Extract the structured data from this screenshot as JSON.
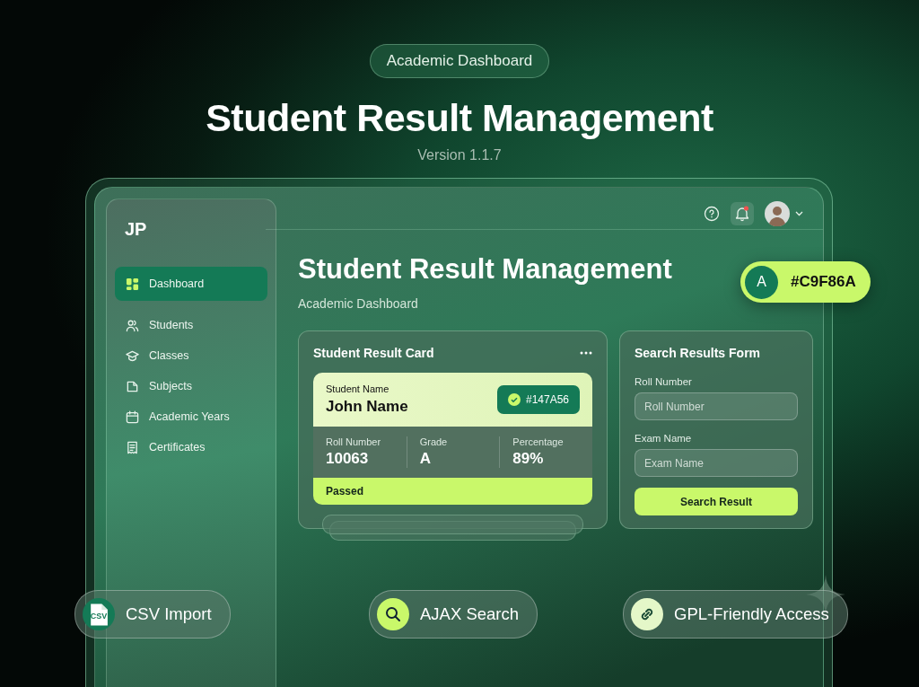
{
  "hero": {
    "badge": "Academic Dashboard",
    "title": "Student Result Management",
    "version": "Version 1.1.7"
  },
  "sidebar": {
    "logo": "JP",
    "items": [
      {
        "label": "Dashboard",
        "selected": true
      },
      {
        "label": "Students",
        "selected": false
      },
      {
        "label": "Classes",
        "selected": false
      },
      {
        "label": "Subjects",
        "selected": false
      },
      {
        "label": "Academic Years",
        "selected": false
      },
      {
        "label": "Certificates",
        "selected": false
      }
    ]
  },
  "page": {
    "title": "Student Result Management",
    "subtitle": "Academic Dashboard"
  },
  "color_chip": {
    "letter": "A",
    "label": "#C9F86A"
  },
  "result_card": {
    "title": "Student Result Card",
    "student_label": "Student Name",
    "student_name": "John Name",
    "badge": "#147A56",
    "stats": [
      {
        "label": "Roll Number",
        "value": "10063"
      },
      {
        "label": "Grade",
        "value": "A"
      },
      {
        "label": "Percentage",
        "value": "89%"
      }
    ],
    "status": "Passed"
  },
  "search_form": {
    "title": "Search Results Form",
    "fields": [
      {
        "label": "Roll Number",
        "placeholder": "Roll Number"
      },
      {
        "label": "Exam Name",
        "placeholder": "Exam Name"
      }
    ],
    "button": "Search Result"
  },
  "features": [
    {
      "kind": "csv",
      "label": "CSV Import",
      "icon_text": "CSV"
    },
    {
      "kind": "search",
      "label": "AJAX Search"
    },
    {
      "kind": "link",
      "label": "GPL-Friendly Access"
    }
  ]
}
